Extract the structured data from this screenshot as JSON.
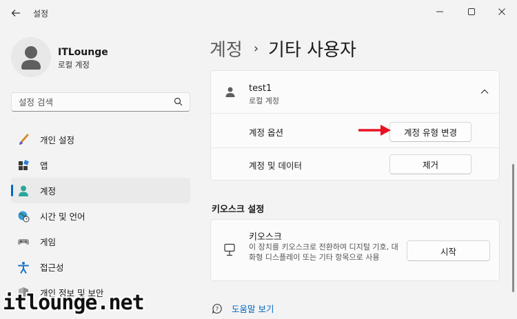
{
  "window": {
    "title": "설정",
    "back_icon": "back-arrow-icon",
    "controls": [
      "minimize-icon",
      "maximize-icon",
      "close-icon"
    ]
  },
  "sidebar": {
    "profile": {
      "name": "ITLounge",
      "subtitle": "로컬 계정"
    },
    "search": {
      "placeholder": "설정 검색"
    },
    "items": [
      {
        "label": "개인 설정",
        "icon": "brush-icon",
        "active": false
      },
      {
        "label": "앱",
        "icon": "apps-icon",
        "active": false
      },
      {
        "label": "계정",
        "icon": "account-icon",
        "active": true
      },
      {
        "label": "시간 및 언어",
        "icon": "globe-clock-icon",
        "active": false
      },
      {
        "label": "게임",
        "icon": "gamepad-icon",
        "active": false
      },
      {
        "label": "접근성",
        "icon": "accessibility-icon",
        "active": false
      },
      {
        "label": "개인 정보 및 보안",
        "icon": "shield-icon",
        "active": false
      }
    ]
  },
  "main": {
    "breadcrumb": {
      "parent": "계정",
      "separator": "›",
      "current": "기타 사용자"
    },
    "user_card": {
      "name": "test1",
      "subtitle": "로컬 계정",
      "rows": [
        {
          "label": "계정 옵션",
          "button": "계정 유형 변경"
        },
        {
          "label": "계정 및 데이터",
          "button": "제거"
        }
      ]
    },
    "kiosk_section": {
      "title": "키오스크 설정",
      "card_title": "키오스크",
      "description": "이 장치를 키오스크로 전환하여 디지털 기호, 대화형 디스플레이 또는 기타 항목으로 사용",
      "button": "시작"
    },
    "help_link": "도움말 보기"
  },
  "watermark": "itlounge.net",
  "colors": {
    "accent": "#0067c0",
    "arrow": "#e81123",
    "background": "#f3f3f3",
    "card": "#fbfbfb"
  }
}
